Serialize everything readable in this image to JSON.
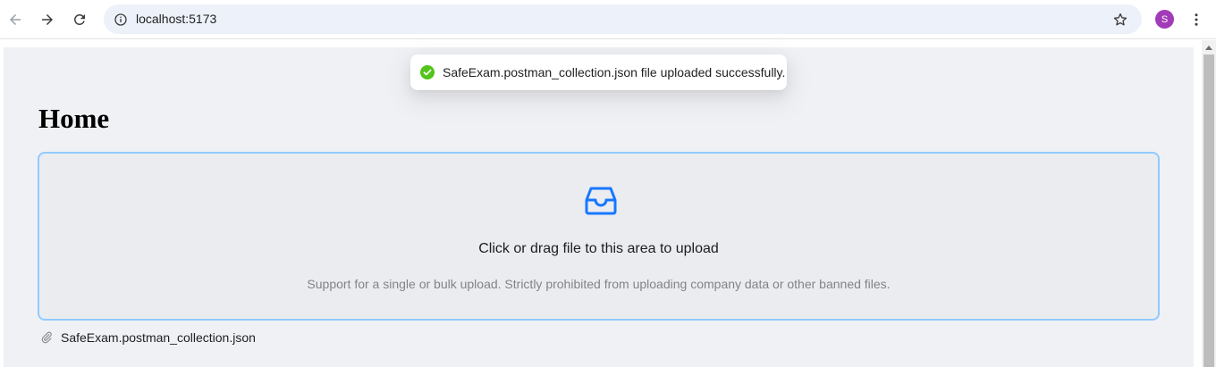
{
  "browser": {
    "url": "localhost:5173",
    "profile_initial": "S",
    "profile_color": "#a23bb8"
  },
  "page": {
    "title": "Home"
  },
  "upload": {
    "drag_text": "Click or drag file to this area to upload",
    "hint_text": "Support for a single or bulk upload. Strictly prohibited from uploading company data or other banned files.",
    "accent_color": "#1677ff",
    "border_color": "#91caff"
  },
  "file_list": [
    {
      "name": "SafeExam.postman_collection.json"
    }
  ],
  "toast": {
    "message": "SafeExam.postman_collection.json file uploaded successfully.",
    "status": "success",
    "status_color": "#52c41a"
  }
}
